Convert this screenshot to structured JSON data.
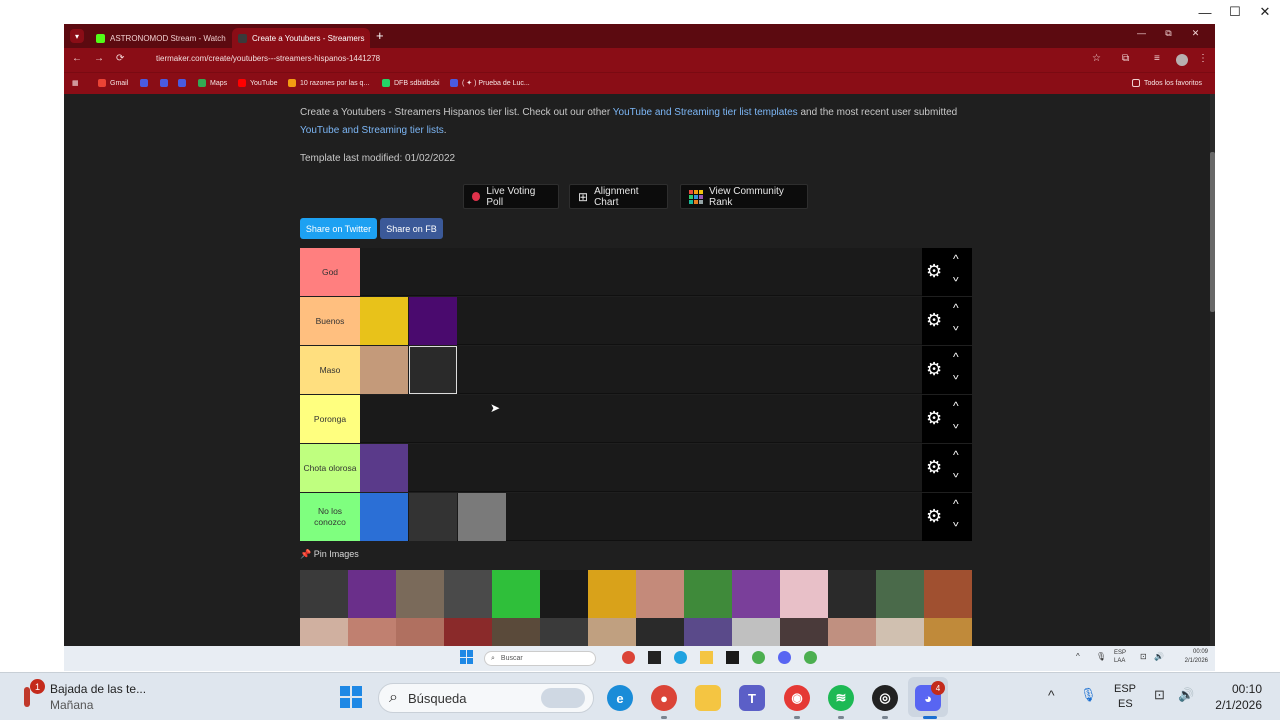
{
  "outer_window": {
    "controls": [
      "—",
      "☐",
      "✕"
    ]
  },
  "browser": {
    "tab_list_icon": "chevron-down-icon",
    "tabs": [
      {
        "title": "ASTRONOMOD Stream - Watch",
        "close": "✕",
        "favicon_color": "#53fc18"
      },
      {
        "title": "Create a Youtubers - Streamers",
        "close": "✕",
        "favicon_color": "#3a3a3a"
      }
    ],
    "new_tab": "+",
    "window_controls": [
      "—",
      "⧉",
      "✕"
    ],
    "nav": {
      "back": "←",
      "forward": "→",
      "reload": "⟳"
    },
    "url": "tiermaker.com/create/youtubers---streamers-hispanos-1441278",
    "bookmarks": [
      {
        "label": "Gmail",
        "color": "#ea4335"
      },
      {
        "label": "",
        "color": "#4a5ae0"
      },
      {
        "label": "",
        "color": "#4a5ae0"
      },
      {
        "label": "",
        "color": "#4a5ae0"
      },
      {
        "label": "Maps",
        "color": "#34a853"
      },
      {
        "label": "YouTube",
        "color": "#ff0000"
      },
      {
        "label": "10 razones por las q...",
        "color": "#f39c12"
      },
      {
        "label": "DFB sdbidbsbi",
        "color": "#25d366"
      },
      {
        "label": "( ✦ ) Prueba de Luc...",
        "color": "#4a5ae0"
      }
    ],
    "bookmarks_folder": "Todos los favoritos"
  },
  "page": {
    "intro_prefix": "Create a Youtubers - Streamers Hispanos tier list. Check out our other",
    "intro_link1": "YouTube and Streaming tier list templates",
    "intro_middle": "and the most recent user submitted",
    "intro_link2": "YouTube and Streaming tier lists",
    "intro_suffix": ".",
    "template_modified": "Template last modified: 01/02/2022",
    "buttons": {
      "live_voting": "Live Voting Poll",
      "alignment": "Alignment Chart",
      "community": "View Community Rank",
      "share_twitter": "Share on Twitter",
      "share_fb": "Share on FB"
    },
    "tiers": [
      {
        "label": "God",
        "color": "#ff7f7f",
        "images": []
      },
      {
        "label": "Buenos",
        "color": "#ffbf7f",
        "images": [
          "#e8c21a",
          "#4a0a6e"
        ]
      },
      {
        "label": "Maso",
        "color": "#ffdf7f",
        "images": [
          "#c49a7a",
          "#2a2a2a"
        ]
      },
      {
        "label": "Poronga",
        "color": "#ffff7f",
        "images": []
      },
      {
        "label": "Chota olorosa",
        "color": "#bfff7f",
        "images": [
          "#5a3a8a"
        ]
      },
      {
        "label": "No los conozco",
        "color": "#7fff7f",
        "images": [
          "#2b6fd6",
          "#333333",
          "#7a7a7a"
        ]
      }
    ],
    "pin_images_label": "Pin Images",
    "pin_row1": [
      "#3a3a3a",
      "#6a2f8a",
      "#7a6a5a",
      "#4a4a4a",
      "#2fbf3a",
      "#1a1a1a",
      "#d9a21a",
      "#c48a7a",
      "#3f8a3a",
      "#7a3f9a",
      "#e8c0c8",
      "#2a2a2a",
      "#4a6a4a",
      "#a05030"
    ],
    "pin_row2": [
      "#d0b0a0",
      "#c08070",
      "#b07060",
      "#8a2a2a",
      "#5a4a3a",
      "#3a3a3a",
      "#c0a080",
      "#2a2a2a",
      "#5a4a8a",
      "#c0c0c0",
      "#4a3a3a",
      "#c09080",
      "#d0c0b0",
      "#c08a3a"
    ]
  },
  "mini_taskbar": {
    "search": "Buscar",
    "lang": "ESP\nLAA",
    "time": "00:09",
    "date": "2/1/2026"
  },
  "taskbar": {
    "notification_count": "1",
    "notification_title": "Bajada de las te...",
    "notification_sub": "Mañana",
    "search_label": "Búsqueda",
    "lang_top": "ESP",
    "lang_bottom": "ES",
    "time": "00:10",
    "date": "2/1/2026",
    "discord_badge": "4"
  }
}
